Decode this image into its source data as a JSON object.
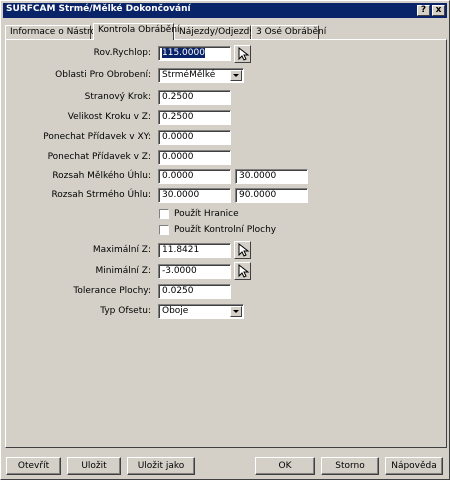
{
  "window": {
    "title": "SURFCAM Strmé/Mělké Dokončování",
    "help_glyph": "?",
    "close_glyph": "x"
  },
  "tabs": [
    {
      "label": "Informace o Nástroji"
    },
    {
      "label": "Kontrola Obrábění"
    },
    {
      "label": "Nájezdy/Odjezdy"
    },
    {
      "label": "3 Osé Obrábění"
    }
  ],
  "form": {
    "rov_rychlop": {
      "label": "Rov.Rychlop:",
      "value": "115.0000"
    },
    "oblasti": {
      "label": "Oblasti Pro Obrobení:",
      "value": "StrméMělké"
    },
    "stranovy_krok": {
      "label": "Stranový Krok:",
      "value": "0.2500"
    },
    "velikost_kroku": {
      "label": "Velikost Kroku v Z:",
      "value": "0.2500"
    },
    "pridavek_xy": {
      "label": "Ponechat Přídavek v XY:",
      "value": "0.0000"
    },
    "pridavek_z": {
      "label": "Ponechat Přídavek v Z:",
      "value": "0.0000"
    },
    "melky_uhel": {
      "label": "Rozsah Mělkého Úhlu:",
      "from": "0.0000",
      "to": "30.0000"
    },
    "strmy_uhel": {
      "label": "Rozsah Strmého Úhlu:",
      "from": "30.0000",
      "to": "90.0000"
    },
    "pouzit_hranice": {
      "label": "Použít Hranice",
      "checked": false
    },
    "pouzit_kontrolni": {
      "label": "Použít Kontrolní Plochy",
      "checked": false
    },
    "max_z": {
      "label": "Maximální Z:",
      "value": "11.8421"
    },
    "min_z": {
      "label": "Minimální Z:",
      "value": "-3.0000"
    },
    "tolerance": {
      "label": "Tolerance Plochy:",
      "value": "0.0250"
    },
    "typ_ofsetu": {
      "label": "Typ Ofsetu:",
      "value": "Oboje"
    }
  },
  "buttons": {
    "open": "Otevřít",
    "save": "Uložit",
    "save_as": "Uložit jako",
    "ok": "OK",
    "cancel": "Storno",
    "help": "Nápověda"
  },
  "icons": {
    "pick": "cursor-pick-icon"
  }
}
